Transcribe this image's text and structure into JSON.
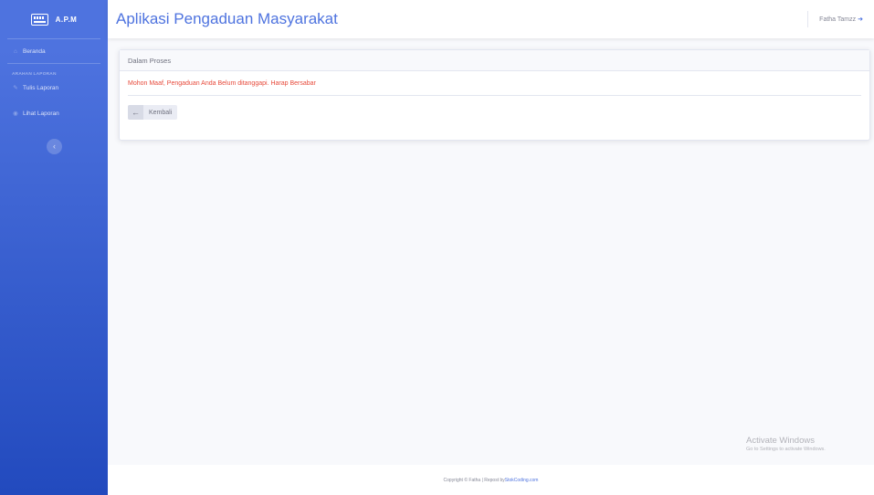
{
  "sidebar": {
    "brand": "A.P.M",
    "items": [
      {
        "label": "Beranda",
        "icon": "home-icon"
      },
      {
        "label": "Tulis Laporan",
        "icon": "edit-icon"
      },
      {
        "label": "Lihat Laporan",
        "icon": "eye-icon"
      }
    ],
    "section_heading": "ARAHAN LAPORAN"
  },
  "topbar": {
    "title": "Aplikasi Pengaduan Masyarakat",
    "user_name": "Fatha Tamzz"
  },
  "card": {
    "header": "Dalam Proses",
    "message": "Mohon Maaf, Pengaduan Anda Belum ditanggapi. Harap Bersabar",
    "back_label": "Kembali"
  },
  "watermark": {
    "title": "Activate Windows",
    "subtitle": "Go to Settings to activate Windows."
  },
  "footer": {
    "text": "Copyright © Fatha | Repost by ",
    "link": "StokCoding.com"
  },
  "colors": {
    "primary": "#4e73df",
    "sidebar_bottom": "#224abe",
    "alert": "#e74a3b"
  }
}
